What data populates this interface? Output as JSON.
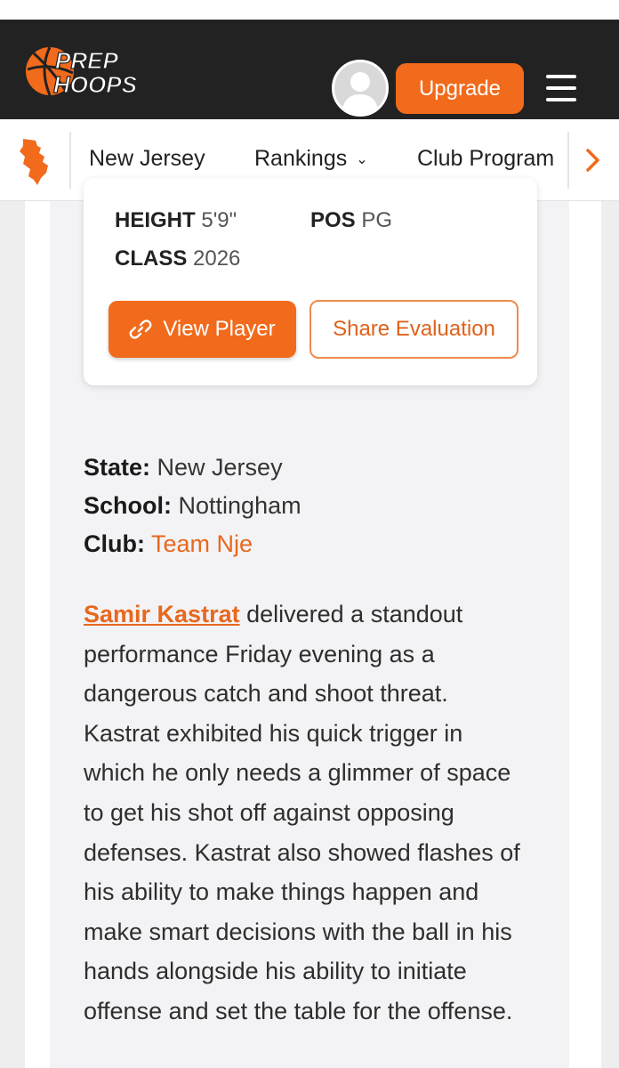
{
  "header": {
    "logo_text_line1": "PREP",
    "logo_text_line2": "HOOPS",
    "upgrade_label": "Upgrade"
  },
  "subnav": {
    "items": [
      {
        "label": "New Jersey"
      },
      {
        "label": "Rankings"
      },
      {
        "label": "Club Program"
      }
    ]
  },
  "player_card": {
    "height_label": "HEIGHT",
    "height_value": "5'9\"",
    "pos_label": "POS",
    "pos_value": "PG",
    "class_label": "CLASS",
    "class_value": "2026",
    "view_player_label": "View Player",
    "share_label": "Share Evaluation"
  },
  "info": {
    "state_label": "State:",
    "state_value": "New Jersey",
    "school_label": "School:",
    "school_value": "Nottingham",
    "club_label": "Club:",
    "club_value": "Team Nje"
  },
  "article": {
    "player_name": "Samir Kastrat",
    "body": "delivered a standout performance Friday evening as a dangerous catch and shoot threat. Kastrat exhibited his quick trigger in which he only needs a glimmer of space to get his shot off against opposing defenses. Kastrat also showed flashes of his ability to make things happen and make smart decisions with the ball in his hands alongside his ability to initiate offense and set the table for the offense."
  },
  "colors": {
    "accent": "#f26a1b",
    "header_bg": "#222222"
  },
  "icons": {
    "logo": "basketball-logo",
    "avatar": "user-avatar-icon",
    "menu": "hamburger-menu-icon",
    "state": "new-jersey-state-icon",
    "rankings_caret": "chevron-down-icon",
    "nav_next": "chevron-right-icon",
    "link": "link-icon"
  }
}
